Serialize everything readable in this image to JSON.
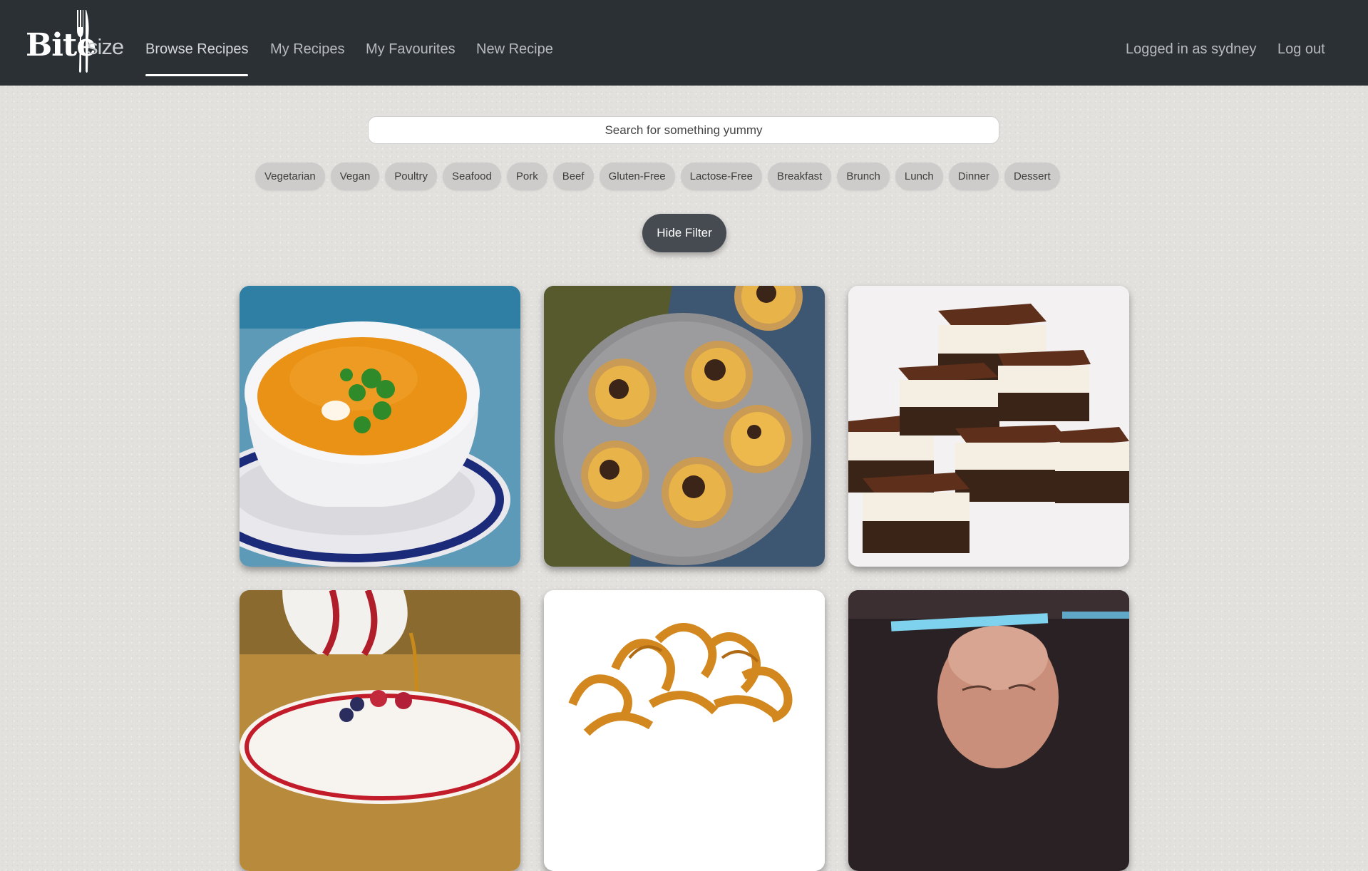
{
  "brand": {
    "logo_text": "Bite",
    "logo_suffix": "size"
  },
  "nav": {
    "left": [
      {
        "label": "Browse Recipes",
        "active": true
      },
      {
        "label": "My Recipes"
      },
      {
        "label": "My Favourites"
      },
      {
        "label": "New Recipe"
      }
    ],
    "user_label": "Logged in as sydney",
    "logout_label": "Log out"
  },
  "search": {
    "placeholder": "Search for something yummy",
    "value": ""
  },
  "filters": [
    "Vegetarian",
    "Vegan",
    "Poultry",
    "Seafood",
    "Pork",
    "Beef",
    "Gluten-Free",
    "Lactose-Free",
    "Breakfast",
    "Brunch",
    "Lunch",
    "Dinner",
    "Dessert"
  ],
  "hide_filter_label": "Hide Filter",
  "recipes": [
    {
      "image": "pumpkin-soup-photo"
    },
    {
      "image": "custard-tarts-photo"
    },
    {
      "image": "chocolate-slice-photo"
    },
    {
      "image": "pancakes-syrup-photo"
    },
    {
      "image": "curly-fries-photo"
    },
    {
      "image": "bald-man-photo"
    }
  ],
  "colors": {
    "navbar": "#2b3035",
    "background": "#e3e1de",
    "chip": "#cdcccb",
    "button": "#464b52"
  }
}
